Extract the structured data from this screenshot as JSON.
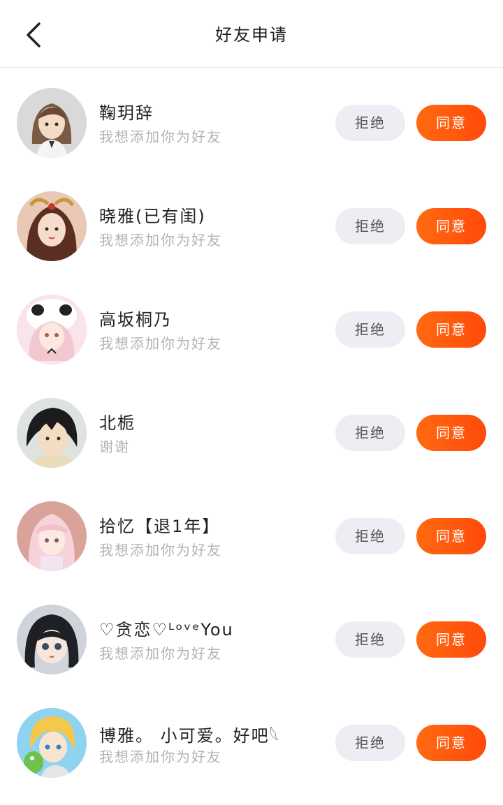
{
  "header": {
    "title": "好友申请"
  },
  "requests": [
    {
      "name": "鞠玥辞",
      "message": "我想添加你为好友",
      "reject": "拒绝",
      "accept": "同意"
    },
    {
      "name": "晓雅(已有闺)",
      "message": "我想添加你为好友",
      "reject": "拒绝",
      "accept": "同意"
    },
    {
      "name": "高坂桐乃",
      "message": "我想添加你为好友",
      "reject": "拒绝",
      "accept": "同意"
    },
    {
      "name": "北栀",
      "message": "谢谢",
      "reject": "拒绝",
      "accept": "同意"
    },
    {
      "name": "拾忆【退1年】",
      "message": "我想添加你为好友",
      "reject": "拒绝",
      "accept": "同意"
    },
    {
      "name": "♡贪恋♡ᴸᵒᵛᵉYou",
      "message": "我想添加你为好友",
      "reject": "拒绝",
      "accept": "同意"
    },
    {
      "name": "博雅。 小可爱。好吧𓆩",
      "message": "我想添加你为好友",
      "reject": "拒绝",
      "accept": "同意"
    }
  ],
  "colors": {
    "accent": "#ff5a0c",
    "reject_bg": "#eceef3",
    "muted_text": "#b3b3b3"
  },
  "icons": {
    "back": "chevron-left-icon"
  }
}
